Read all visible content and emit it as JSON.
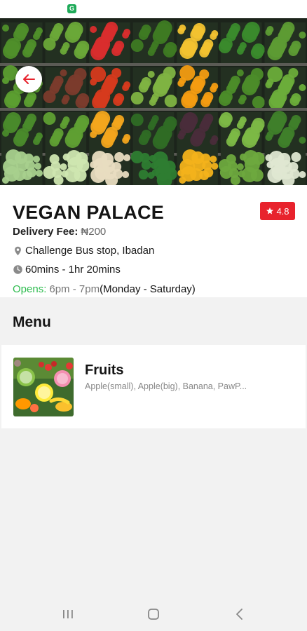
{
  "status_bar": {
    "notification_icon": "green-app-icon",
    "notification_glyph": "G"
  },
  "hero": {
    "image": "vegetable-shelves-photo",
    "back_icon": "arrow-left-icon"
  },
  "restaurant": {
    "name": "VEGAN PALACE",
    "rating": "4.8",
    "rating_icon": "star-icon",
    "delivery_fee_label": "Delivery Fee:",
    "delivery_fee_value": "₦200",
    "location": "Challenge Bus stop, Ibadan",
    "location_icon": "location-pin-icon",
    "delivery_time": "60mins - 1hr 20mins",
    "time_icon": "clock-icon",
    "opens_label": "Opens:",
    "opens_hours": "6pm - 7pm",
    "opens_days": "(Monday - Saturday)"
  },
  "menu": {
    "title": "Menu",
    "items": [
      {
        "name": "Fruits",
        "description": "Apple(small), Apple(big), Banana, PawP..."
      }
    ]
  },
  "colors": {
    "accent_red": "#e8232d",
    "open_green": "#2ebc4f"
  },
  "nav": {
    "recents_icon": "recents-icon",
    "home_icon": "home-icon",
    "back_icon": "back-chevron-icon"
  }
}
